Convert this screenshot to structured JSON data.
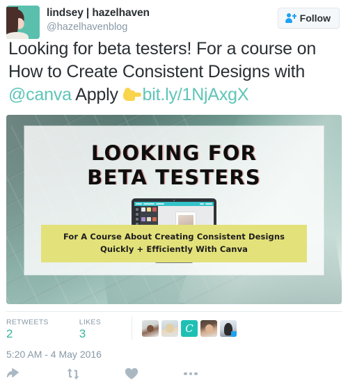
{
  "user": {
    "display_name": "lindsey | hazelhaven",
    "handle": "@hazelhavenblog",
    "avatar_icon": "user-avatar-photo",
    "avatar_background_color": "#5bbfae"
  },
  "follow_button": {
    "label": "Follow",
    "icon": "person-add-icon",
    "icon_color": "#1da1f2"
  },
  "tweet": {
    "text_part_1": "Looking for beta testers! For a course on How to Create Consistent Designs with ",
    "mention": "@canva",
    "text_part_2": " Apply ",
    "emoji": "point-right-emoji",
    "link": "bit.ly/1NjAxgX",
    "link_color": "#5fc5b8"
  },
  "media": {
    "alt_name": "beta-testers-promo-image",
    "headline_line_1": "LOOKING FOR",
    "headline_line_2": "BETA TESTERS",
    "banner_line_1": "For A Course About Creating Consistent Designs",
    "banner_line_2": "Quickly + Efficiently With Canva",
    "banner_color": "#e3e17a",
    "background_color": "#9cc2b9",
    "illustration": "desktop-monitor-canva-editor"
  },
  "stats": {
    "retweets_label": "RETWEETS",
    "retweets_value": "2",
    "likes_label": "LIKES",
    "likes_value": "3",
    "value_color": "#3ab39c",
    "facepile": [
      {
        "name": "liker-avatar-1",
        "type": "photo"
      },
      {
        "name": "liker-avatar-2",
        "type": "photo"
      },
      {
        "name": "liker-avatar-3",
        "type": "canva-logo",
        "letter": "C"
      },
      {
        "name": "liker-avatar-4",
        "type": "photo"
      },
      {
        "name": "liker-avatar-5",
        "type": "photo-with-badge"
      }
    ]
  },
  "timestamp": "5:20 AM - 4 May 2016",
  "actions": [
    {
      "name": "reply-button",
      "icon": "reply-arrow-icon"
    },
    {
      "name": "retweet-button",
      "icon": "retweet-icon"
    },
    {
      "name": "like-button",
      "icon": "heart-icon"
    },
    {
      "name": "more-button",
      "icon": "ellipsis-icon"
    }
  ]
}
